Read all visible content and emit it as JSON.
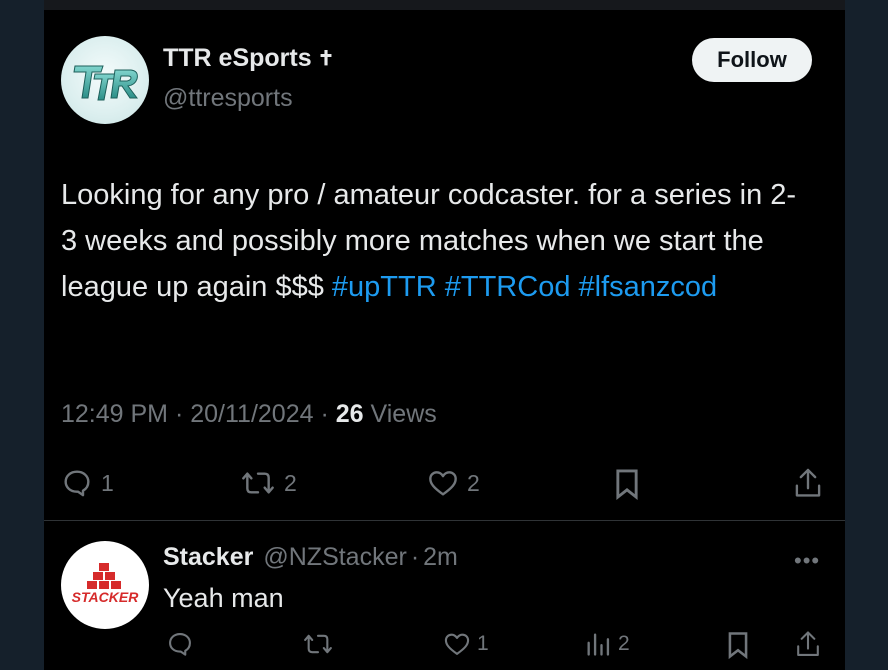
{
  "tweet": {
    "author_name": "TTR eSports",
    "author_badge": "✝",
    "author_handle": "@ttresports",
    "follow_label": "Follow",
    "text_plain": "Looking for any pro / amateur codcaster. for a series in 2-3 weeks and possibly more matches when we start the league up again $$$ ",
    "hashtags": [
      "#upTTR",
      "#TTRCod",
      "#lfsanzcod"
    ],
    "time": "12:49 PM",
    "date": "20/11/2024",
    "views_count": "26",
    "views_label": "Views",
    "separator": "·",
    "actions": {
      "replies": "1",
      "reposts": "2",
      "likes": "2"
    },
    "avatar_logo_text": "TTR"
  },
  "reply": {
    "author_name": "Stacker",
    "author_handle": "@NZStacker",
    "separator": "·",
    "time": "2m",
    "more_label": "•••",
    "text": "Yeah man",
    "avatar_logo_text": "STACKER",
    "actions": {
      "likes": "1",
      "views": "2"
    }
  },
  "colors": {
    "background": "#000000",
    "outer_background": "#15202b",
    "text_primary": "#e7e9ea",
    "text_secondary": "#71767b",
    "link": "#1d9bf0",
    "follow_bg": "#eff3f4",
    "stacker_red": "#d62b2b",
    "ttr_teal": "#4fb8b0"
  }
}
